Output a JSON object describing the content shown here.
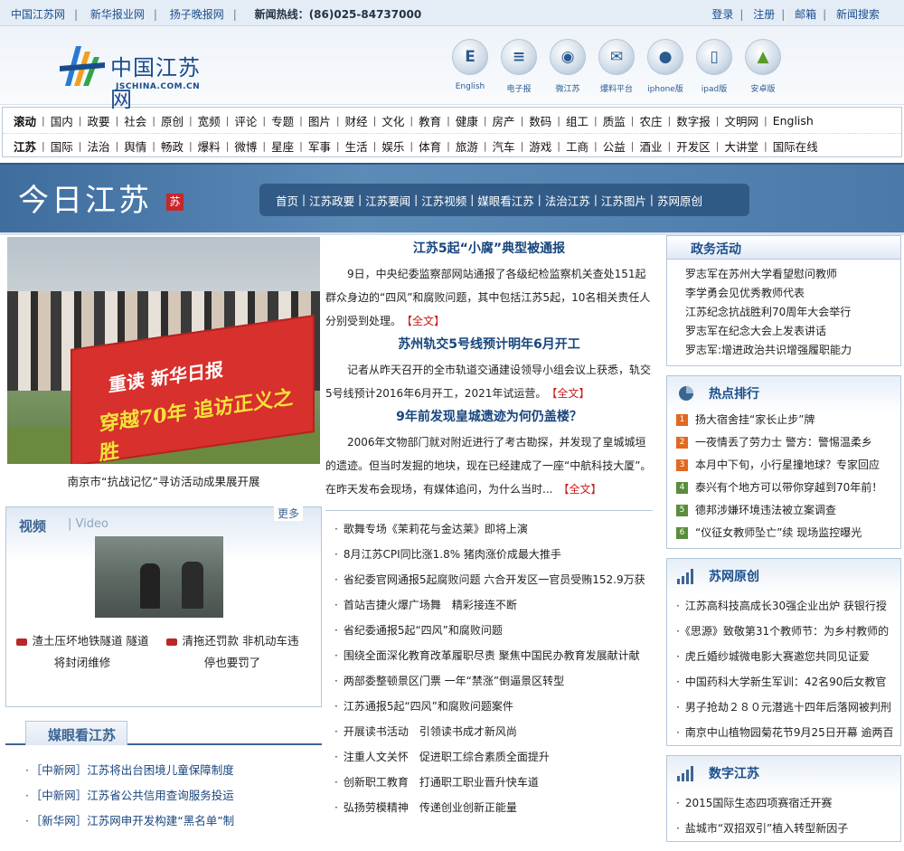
{
  "topbar": {
    "links": [
      "中国江苏网",
      "新华报业网",
      "扬子晚报网"
    ],
    "hotline_label": "新闻热线：",
    "hotline": "(86)025-84737000",
    "right_links": [
      "登录",
      "注册",
      "邮箱",
      "新闻搜索"
    ]
  },
  "logo": {
    "cn": "中国江苏网",
    "en": "JSCHINA.COM.CN"
  },
  "apps": [
    {
      "label": "English",
      "icon": "e-icon"
    },
    {
      "label": "电子报",
      "icon": "newspaper-icon"
    },
    {
      "label": "微江苏",
      "icon": "weibo-icon"
    },
    {
      "label": "爆料平台",
      "icon": "tip-icon"
    },
    {
      "label": "iphone版",
      "icon": "apple-icon"
    },
    {
      "label": "ipad版",
      "icon": "ipad-icon"
    },
    {
      "label": "安卓版",
      "icon": "android-icon"
    }
  ],
  "nav": {
    "row1": [
      "滚动",
      "国内",
      "政要",
      "社会",
      "原创",
      "宽频",
      "评论",
      "专题",
      "图片",
      "财经",
      "文化",
      "教育",
      "健康",
      "房产",
      "数码",
      "组工",
      "质监",
      "农庄",
      "数字报",
      "文明网",
      "English"
    ],
    "row2": [
      "江苏",
      "国际",
      "法治",
      "舆情",
      "畅政",
      "爆料",
      "微博",
      "星座",
      "军事",
      "生活",
      "娱乐",
      "体育",
      "旅游",
      "汽车",
      "游戏",
      "工商",
      "公益",
      "酒业",
      "开发区",
      "大讲堂",
      "国际在线"
    ]
  },
  "banner": {
    "title": "今日江苏",
    "seal": "苏",
    "nav": [
      "首页",
      "江苏政要",
      "江苏要闻",
      "江苏视频",
      "媒眼看江苏",
      "法治江苏",
      "江苏图片",
      "苏网原创"
    ]
  },
  "photo_caption": "南京市“抗战记忆”寻访活动成果展开展",
  "photo_banner": {
    "line1": "重读 新华日报",
    "line2": "穿越70年 追访正义之胜"
  },
  "articles": [
    {
      "title": "江苏5起“小腐”典型被通报",
      "body": "9日，中央纪委监察部网站通报了各级纪检监察机关查处151起群众身边的“四风”和腐败问题，其中包括江苏5起，10名相关责任人分别受到处理。",
      "more": "【全文】"
    },
    {
      "title": "苏州轨交5号线预计明年6月开工",
      "body": "记者从昨天召开的全市轨道交通建设领导小组会议上获悉，轨交5号线预计2016年6月开工，2021年试运营。",
      "more": "【全文】"
    },
    {
      "title": "9年前发现皇城遗迹为何仍盖楼？",
      "body": "2006年文物部门就对附近进行了考古勘探，并发现了皇城城垣的遗迹。但当时发掘的地块，现在已经建成了一座“中航科技大厦”。在昨天发布会现场，有媒体追问，为什么当时...",
      "more": "【全文】"
    }
  ],
  "news_list": [
    "歌舞专场《茉莉花与金达莱》即将上演",
    "8月江苏CPI同比涨1.8% 猪肉涨价成最大推手",
    "省纪委官网通报5起腐败问题 六合开发区一官员受贿152.9万获",
    "首站吉捷火爆广场舞　精彩接连不断",
    "省纪委通报5起“四风”和腐败问题",
    "围绕全面深化教育改革履职尽责 聚焦中国民办教育发展献计献",
    "两部委整顿景区门票 一年“禁涨”倒逼景区转型",
    "江苏通报5起“四风”和腐败问题案件",
    "开展读书活动　引领读书成才新风尚",
    "注重人文关怀　促进职工综合素质全面提升",
    "创新职工教育　打通职工职业晋升快车道",
    "弘扬劳模精神　传递创业创新正能量"
  ],
  "video": {
    "title": "视频",
    "subtitle": "Video",
    "more": "更多",
    "items": [
      "渣土压坏地铁隧道 隧道将封闭维修",
      "清拖还罚款 非机动车违停也要罚了"
    ]
  },
  "media": {
    "title": "媒眼看江苏",
    "items": [
      "［中新网］江苏将出台困境儿童保障制度",
      "［中新网］江苏省公共信用查询服务投运",
      "［新华网］江苏网申开发构建“黑名单”制"
    ]
  },
  "politics": {
    "title": "政务活动",
    "items": [
      "罗志军在苏州大学看望慰问教师",
      "李学勇会见优秀教师代表",
      "江苏纪念抗战胜利70周年大会举行",
      "罗志军在纪念大会上发表讲话",
      "罗志军:增进政治共识增强履职能力"
    ]
  },
  "hot": {
    "title": "热点排行",
    "items": [
      "扬大宿舍挂“家长止步”牌",
      "一夜情丢了劳力士 警方：警惕温柔乡",
      "本月中下旬，小行星撞地球？专家回应",
      "泰兴有个地方可以带你穿越到70年前！",
      "德邦涉嫌环境违法被立案调查",
      "“仪征女教师坠亡”续 现场监控曝光"
    ]
  },
  "original": {
    "title": "苏网原创",
    "items": [
      "江苏高科技高成长30强企业出炉 获银行授",
      "《思源》致敬第31个教师节：为乡村教师的",
      "虎丘婚纱城微电影大赛邀您共同见证爱",
      "中国药科大学新生军训：42名90后女教官",
      "男子抢劫２８０元潜逃十四年后落网被判刑",
      "南京中山植物园菊花节9月25日开幕 逾两百"
    ]
  },
  "digital": {
    "title": "数字江苏",
    "items": [
      "2015国际生态四项赛宿迁开赛",
      "盐城市“双招双引”植入转型新因子"
    ]
  },
  "colors": {
    "brand_blue": "#1d4f8c",
    "accent_red": "#c81d1d",
    "banner_blue": "#4b7aa9"
  }
}
